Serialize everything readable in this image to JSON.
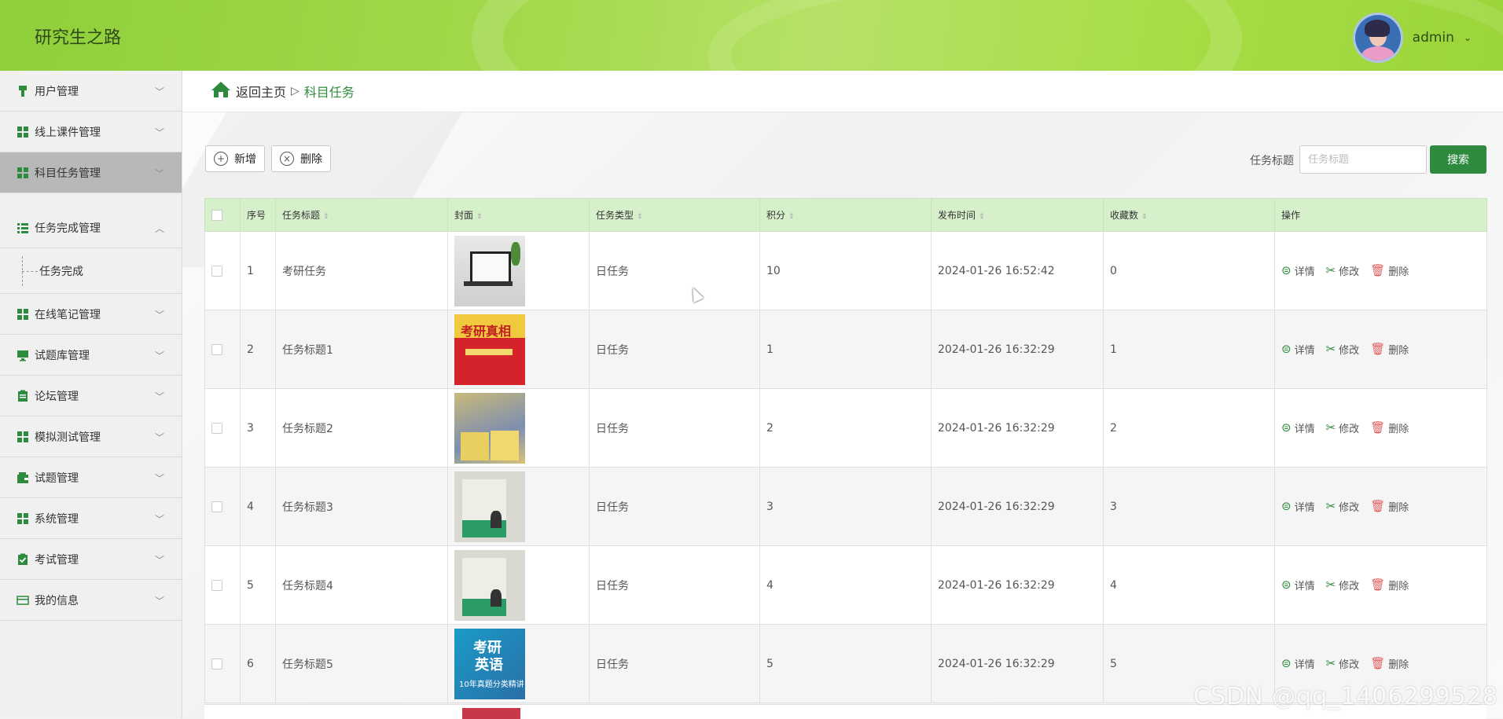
{
  "header": {
    "site_title": "研究生之路",
    "user_name": "admin",
    "caret": "⌄"
  },
  "sidebar": {
    "items": [
      {
        "label": "用户管理",
        "icon": "brush-icon"
      },
      {
        "label": "线上课件管理",
        "icon": "grid-icon"
      },
      {
        "label": "科目任务管理",
        "icon": "grid-icon",
        "active": true
      },
      {
        "label": "任务完成管理",
        "icon": "list-icon",
        "expanded": true
      },
      {
        "label": "在线笔记管理",
        "icon": "grid-icon"
      },
      {
        "label": "试题库管理",
        "icon": "monitor-icon"
      },
      {
        "label": "论坛管理",
        "icon": "clipboard-icon"
      },
      {
        "label": "模拟测试管理",
        "icon": "grid-icon"
      },
      {
        "label": "试题管理",
        "icon": "wallet-icon"
      },
      {
        "label": "系统管理",
        "icon": "grid-icon"
      },
      {
        "label": "考试管理",
        "icon": "check-clipboard-icon"
      },
      {
        "label": "我的信息",
        "icon": "card-icon"
      }
    ],
    "sub_items": [
      {
        "label": "任务完成"
      }
    ]
  },
  "breadcrumb": {
    "home": "返回主页",
    "separator": "▷",
    "current": "科目任务"
  },
  "toolbar": {
    "add_label": "新增",
    "delete_label": "删除",
    "search_label": "任务标题",
    "search_placeholder": "任务标题",
    "search_button": "搜索"
  },
  "table": {
    "headers": [
      "序号",
      "任务标题",
      "封面",
      "任务类型",
      "积分",
      "发布时间",
      "收藏数",
      "操作"
    ],
    "sort_glyph": "⇕",
    "ops": {
      "detail": "详情",
      "edit": "修改",
      "delete": "删除"
    },
    "rows": [
      {
        "index": "1",
        "title": "考研任务",
        "type": "日任务",
        "points": "10",
        "time": "2024-01-26 16:52:42",
        "favorites": "0"
      },
      {
        "index": "2",
        "title": "任务标题1",
        "type": "日任务",
        "points": "1",
        "time": "2024-01-26 16:32:29",
        "favorites": "1"
      },
      {
        "index": "3",
        "title": "任务标题2",
        "type": "日任务",
        "points": "2",
        "time": "2024-01-26 16:32:29",
        "favorites": "2"
      },
      {
        "index": "4",
        "title": "任务标题3",
        "type": "日任务",
        "points": "3",
        "time": "2024-01-26 16:32:29",
        "favorites": "3"
      },
      {
        "index": "5",
        "title": "任务标题4",
        "type": "日任务",
        "points": "4",
        "time": "2024-01-26 16:32:29",
        "favorites": "4"
      },
      {
        "index": "6",
        "title": "任务标题5",
        "type": "日任务",
        "points": "5",
        "time": "2024-01-26 16:32:29",
        "favorites": "5"
      }
    ]
  },
  "covers": {
    "cover2_text": "考研真相",
    "cover5_text1": "考研",
    "cover5_text2": "英语",
    "cover5_text3": "10年真题分类精讲"
  },
  "watermark": "CSDN @qq_1406299528",
  "colors": {
    "primary_green": "#2e8b3d",
    "header_green": "#a3d94b",
    "table_header_bg": "#d7f0cc",
    "delete_red": "#e05d5d"
  }
}
